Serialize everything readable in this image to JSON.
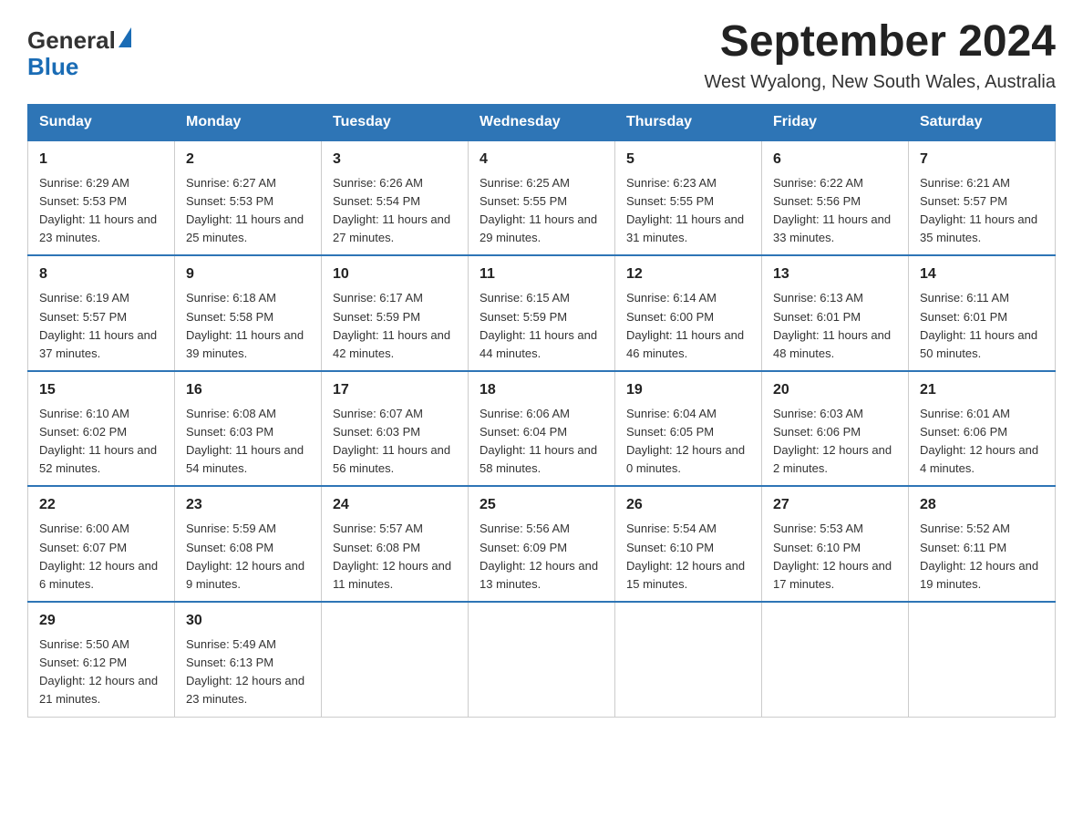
{
  "logo": {
    "text_general": "General",
    "text_blue": "Blue"
  },
  "title": "September 2024",
  "subtitle": "West Wyalong, New South Wales, Australia",
  "days_of_week": [
    "Sunday",
    "Monday",
    "Tuesday",
    "Wednesday",
    "Thursday",
    "Friday",
    "Saturday"
  ],
  "weeks": [
    [
      {
        "day": "1",
        "sunrise": "6:29 AM",
        "sunset": "5:53 PM",
        "daylight": "11 hours and 23 minutes."
      },
      {
        "day": "2",
        "sunrise": "6:27 AM",
        "sunset": "5:53 PM",
        "daylight": "11 hours and 25 minutes."
      },
      {
        "day": "3",
        "sunrise": "6:26 AM",
        "sunset": "5:54 PM",
        "daylight": "11 hours and 27 minutes."
      },
      {
        "day": "4",
        "sunrise": "6:25 AM",
        "sunset": "5:55 PM",
        "daylight": "11 hours and 29 minutes."
      },
      {
        "day": "5",
        "sunrise": "6:23 AM",
        "sunset": "5:55 PM",
        "daylight": "11 hours and 31 minutes."
      },
      {
        "day": "6",
        "sunrise": "6:22 AM",
        "sunset": "5:56 PM",
        "daylight": "11 hours and 33 minutes."
      },
      {
        "day": "7",
        "sunrise": "6:21 AM",
        "sunset": "5:57 PM",
        "daylight": "11 hours and 35 minutes."
      }
    ],
    [
      {
        "day": "8",
        "sunrise": "6:19 AM",
        "sunset": "5:57 PM",
        "daylight": "11 hours and 37 minutes."
      },
      {
        "day": "9",
        "sunrise": "6:18 AM",
        "sunset": "5:58 PM",
        "daylight": "11 hours and 39 minutes."
      },
      {
        "day": "10",
        "sunrise": "6:17 AM",
        "sunset": "5:59 PM",
        "daylight": "11 hours and 42 minutes."
      },
      {
        "day": "11",
        "sunrise": "6:15 AM",
        "sunset": "5:59 PM",
        "daylight": "11 hours and 44 minutes."
      },
      {
        "day": "12",
        "sunrise": "6:14 AM",
        "sunset": "6:00 PM",
        "daylight": "11 hours and 46 minutes."
      },
      {
        "day": "13",
        "sunrise": "6:13 AM",
        "sunset": "6:01 PM",
        "daylight": "11 hours and 48 minutes."
      },
      {
        "day": "14",
        "sunrise": "6:11 AM",
        "sunset": "6:01 PM",
        "daylight": "11 hours and 50 minutes."
      }
    ],
    [
      {
        "day": "15",
        "sunrise": "6:10 AM",
        "sunset": "6:02 PM",
        "daylight": "11 hours and 52 minutes."
      },
      {
        "day": "16",
        "sunrise": "6:08 AM",
        "sunset": "6:03 PM",
        "daylight": "11 hours and 54 minutes."
      },
      {
        "day": "17",
        "sunrise": "6:07 AM",
        "sunset": "6:03 PM",
        "daylight": "11 hours and 56 minutes."
      },
      {
        "day": "18",
        "sunrise": "6:06 AM",
        "sunset": "6:04 PM",
        "daylight": "11 hours and 58 minutes."
      },
      {
        "day": "19",
        "sunrise": "6:04 AM",
        "sunset": "6:05 PM",
        "daylight": "12 hours and 0 minutes."
      },
      {
        "day": "20",
        "sunrise": "6:03 AM",
        "sunset": "6:06 PM",
        "daylight": "12 hours and 2 minutes."
      },
      {
        "day": "21",
        "sunrise": "6:01 AM",
        "sunset": "6:06 PM",
        "daylight": "12 hours and 4 minutes."
      }
    ],
    [
      {
        "day": "22",
        "sunrise": "6:00 AM",
        "sunset": "6:07 PM",
        "daylight": "12 hours and 6 minutes."
      },
      {
        "day": "23",
        "sunrise": "5:59 AM",
        "sunset": "6:08 PM",
        "daylight": "12 hours and 9 minutes."
      },
      {
        "day": "24",
        "sunrise": "5:57 AM",
        "sunset": "6:08 PM",
        "daylight": "12 hours and 11 minutes."
      },
      {
        "day": "25",
        "sunrise": "5:56 AM",
        "sunset": "6:09 PM",
        "daylight": "12 hours and 13 minutes."
      },
      {
        "day": "26",
        "sunrise": "5:54 AM",
        "sunset": "6:10 PM",
        "daylight": "12 hours and 15 minutes."
      },
      {
        "day": "27",
        "sunrise": "5:53 AM",
        "sunset": "6:10 PM",
        "daylight": "12 hours and 17 minutes."
      },
      {
        "day": "28",
        "sunrise": "5:52 AM",
        "sunset": "6:11 PM",
        "daylight": "12 hours and 19 minutes."
      }
    ],
    [
      {
        "day": "29",
        "sunrise": "5:50 AM",
        "sunset": "6:12 PM",
        "daylight": "12 hours and 21 minutes."
      },
      {
        "day": "30",
        "sunrise": "5:49 AM",
        "sunset": "6:13 PM",
        "daylight": "12 hours and 23 minutes."
      },
      null,
      null,
      null,
      null,
      null
    ]
  ],
  "labels": {
    "sunrise": "Sunrise:",
    "sunset": "Sunset:",
    "daylight": "Daylight:"
  }
}
